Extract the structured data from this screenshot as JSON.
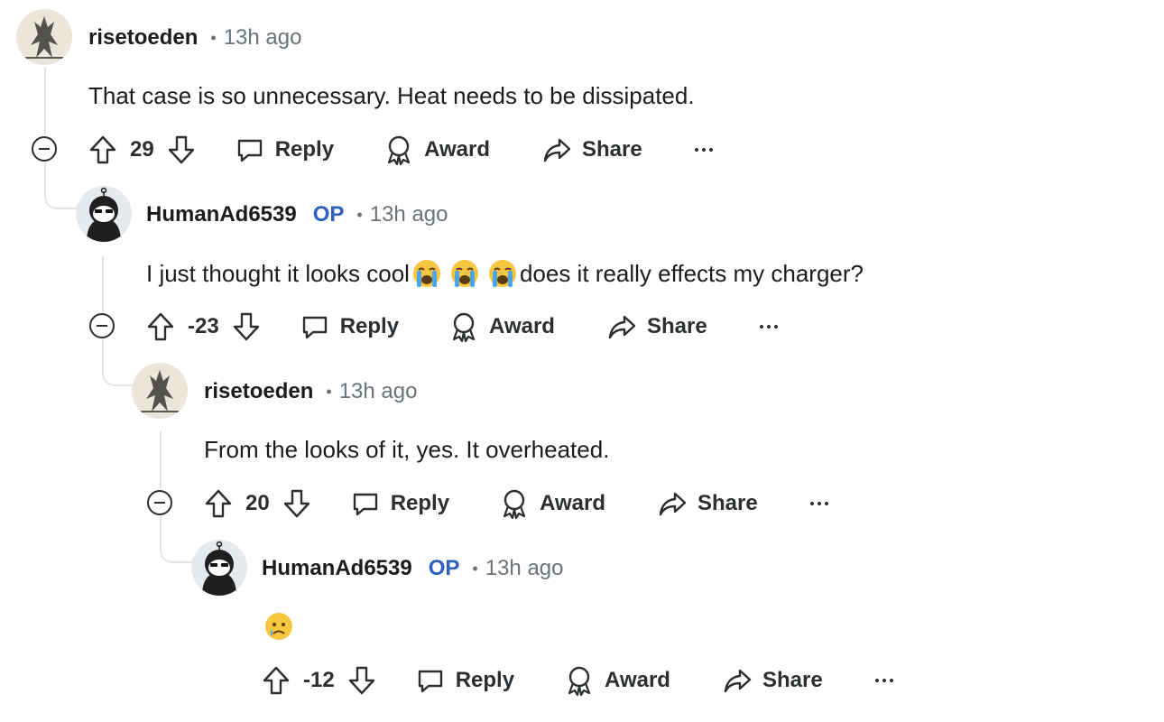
{
  "comments": [
    {
      "username": "risetoeden",
      "op_badge": "",
      "time": "13h ago",
      "text": "That case is so unnecessary. Heat needs to be dissipated.",
      "score": "29"
    },
    {
      "username": "HumanAd6539",
      "op_badge": "OP",
      "time": "13h ago",
      "text_before": "I just thought it looks cool",
      "text_after": "does it really effects my charger?",
      "emojis": [
        "loudly-crying-face",
        "loudly-crying-face",
        "loudly-crying-face"
      ],
      "score": "-23"
    },
    {
      "username": "risetoeden",
      "op_badge": "",
      "time": "13h ago",
      "text": "From the looks of it, yes. It overheated.",
      "score": "20"
    },
    {
      "username": "HumanAd6539",
      "op_badge": "OP",
      "time": "13h ago",
      "emoji": "face-holding-back-tears",
      "score": "-12"
    }
  ],
  "actions": {
    "reply": "Reply",
    "award": "Award",
    "share": "Share"
  },
  "separator": "•",
  "colors": {
    "op": "#2f5fc4",
    "meta": "#6b7378",
    "text": "#1c1c1c",
    "thread_line": "#e2e5e7"
  }
}
